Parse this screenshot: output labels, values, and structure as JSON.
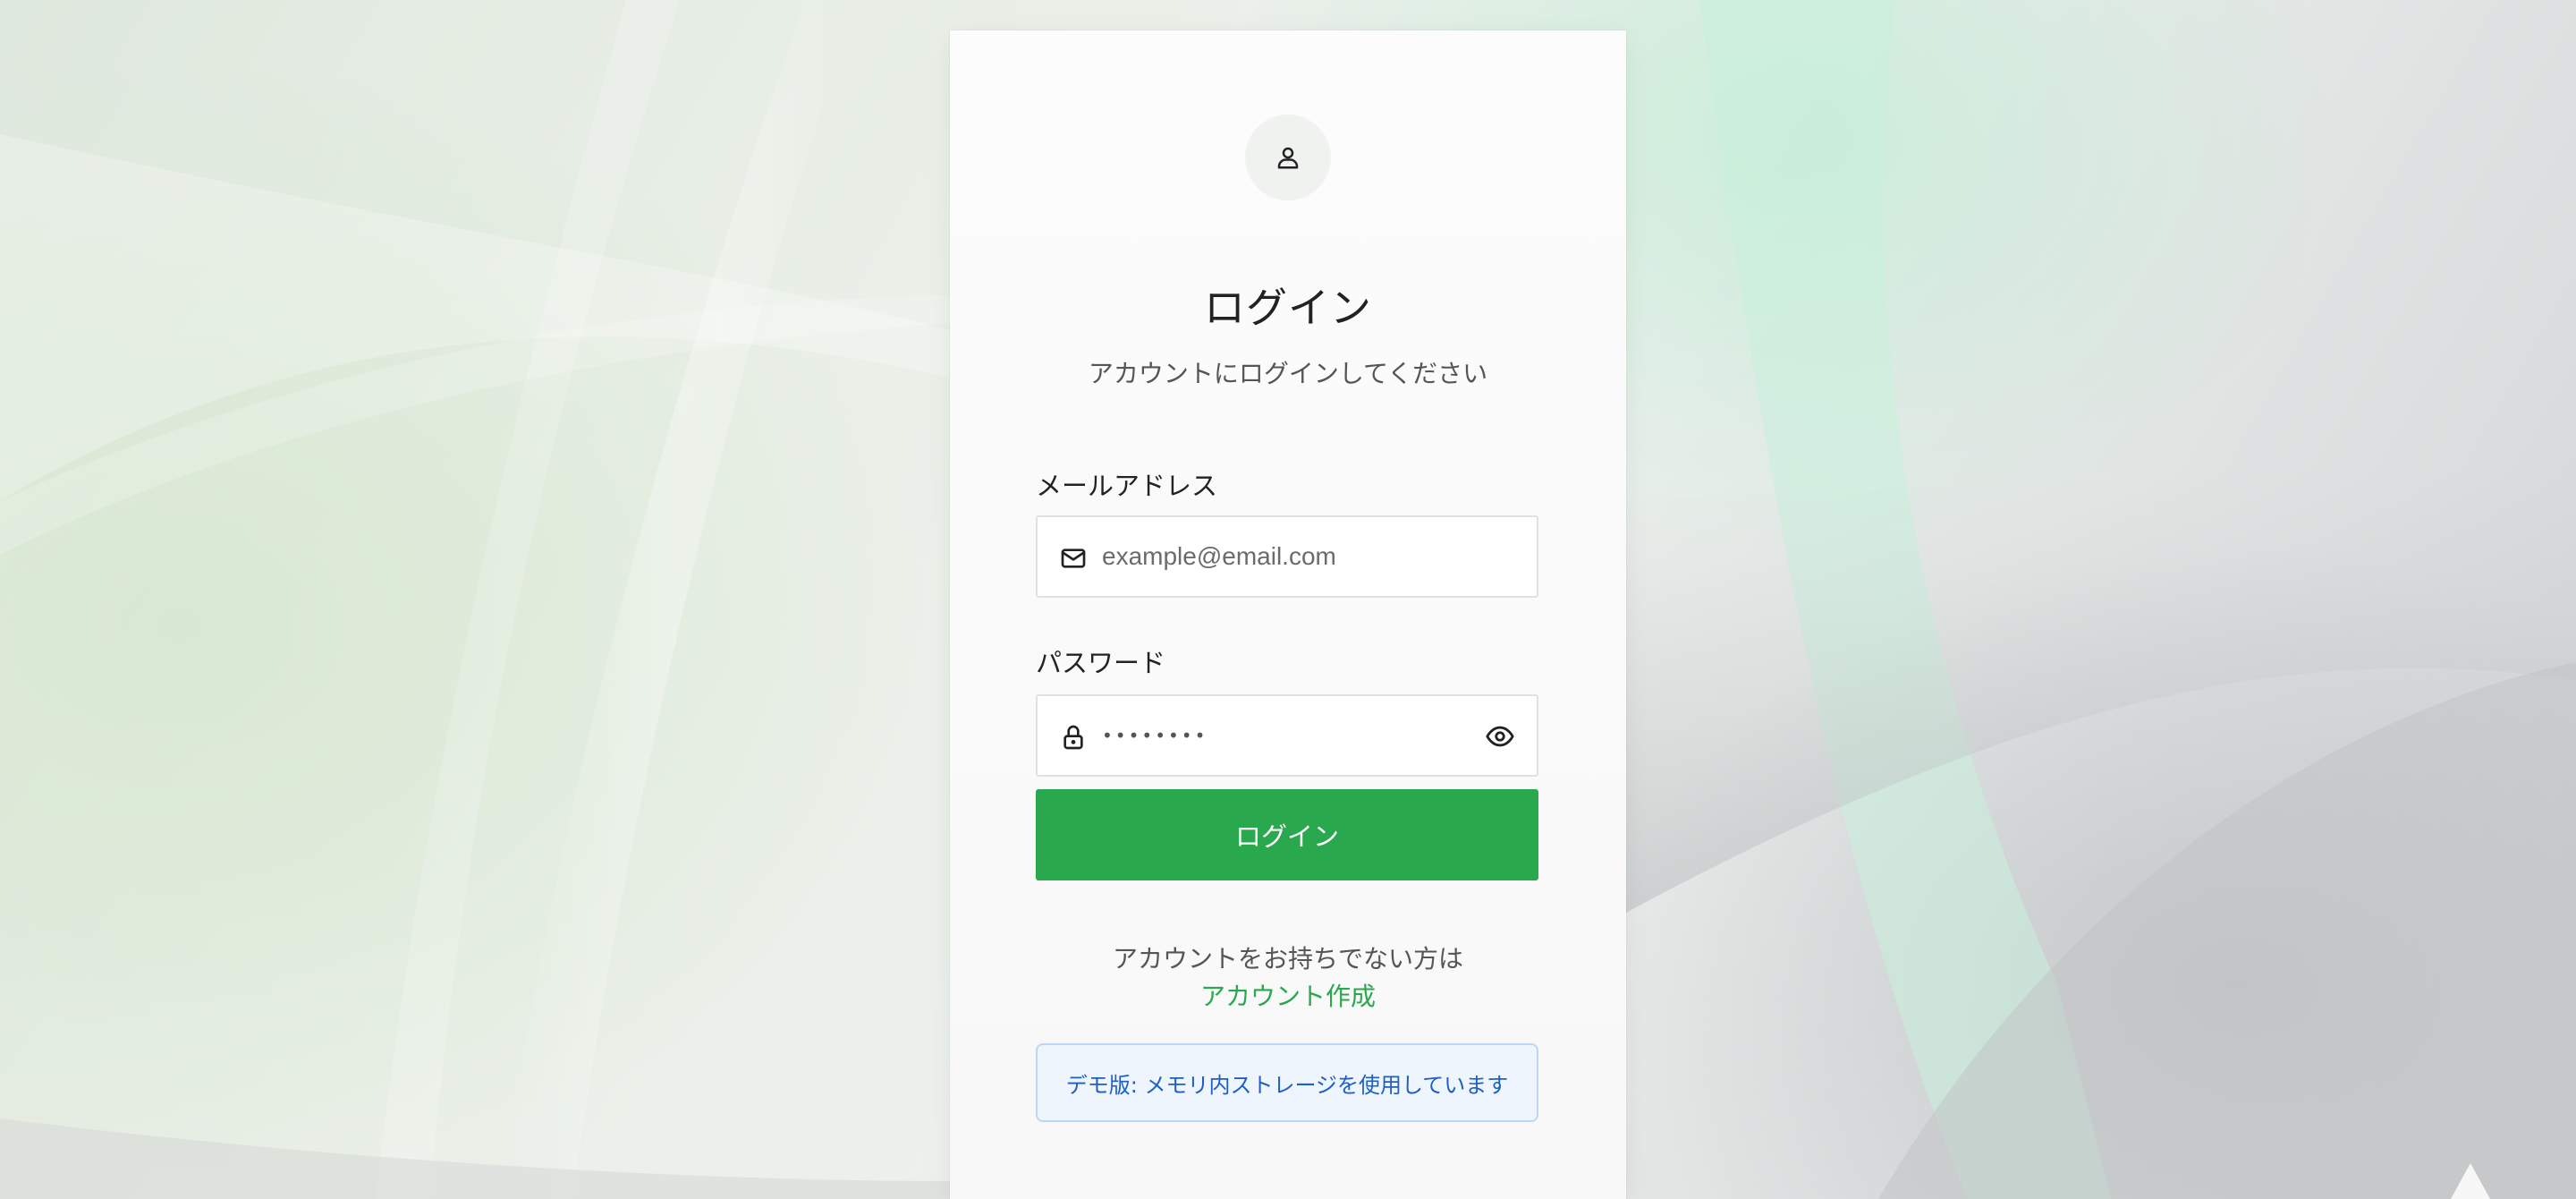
{
  "login": {
    "title": "ログイン",
    "subtitle": "アカウントにログインしてください",
    "email": {
      "label": "メールアドレス",
      "placeholder": "example@email.com",
      "icon": "mail-icon"
    },
    "password": {
      "label": "パスワード",
      "masked_value": "••••••••",
      "icon": "lock-icon",
      "toggle_icon": "eye-icon"
    },
    "submit_label": "ログイン",
    "signup_prompt": "アカウントをお持ちでない方は",
    "signup_link": "アカウント作成",
    "demo_notice": "デモ版: メモリ内ストレージを使用しています"
  },
  "colors": {
    "primary": "#2aa84e",
    "notice_text": "#1f5fc4",
    "notice_bg": "#eef5fd",
    "notice_border": "#bcd6f5"
  }
}
